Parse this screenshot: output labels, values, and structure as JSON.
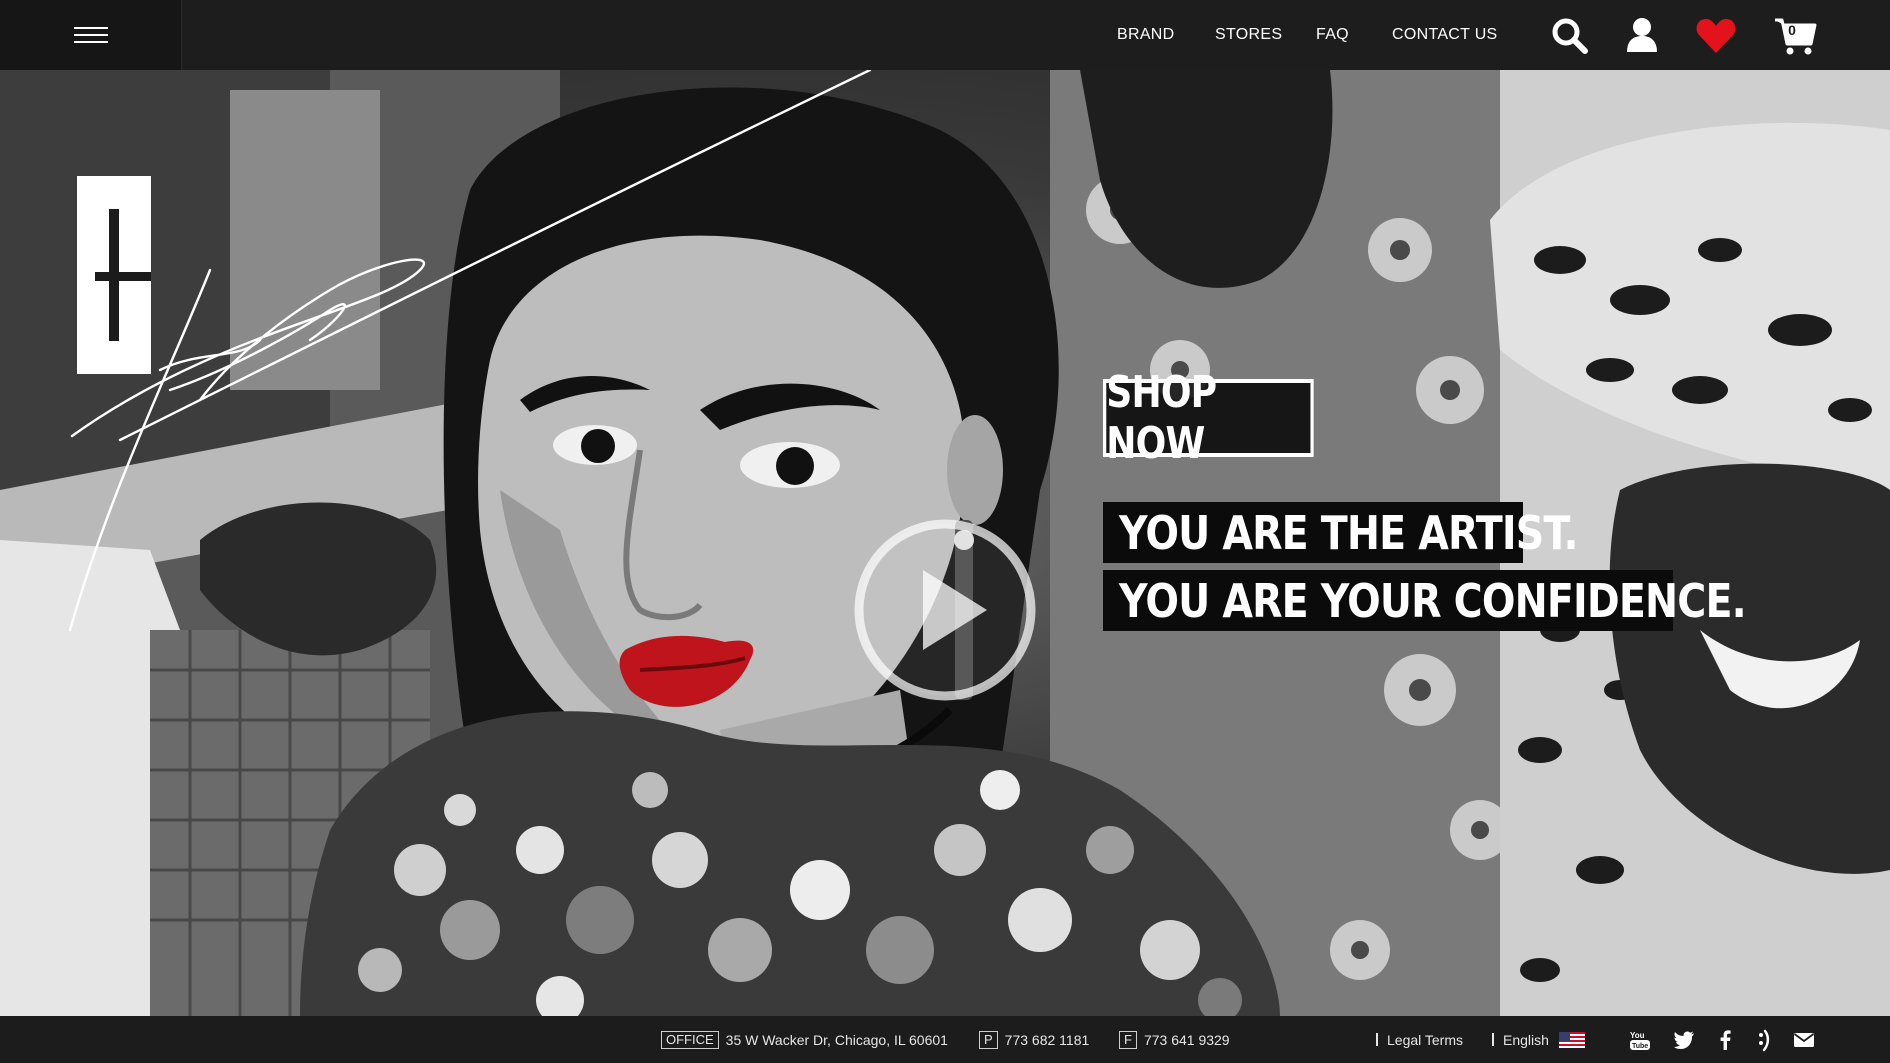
{
  "nav": {
    "items": [
      {
        "label": "BRAND"
      },
      {
        "label": "STORES"
      },
      {
        "label": "FAQ"
      },
      {
        "label": "CONTACT US"
      }
    ],
    "cart_count": "0",
    "icons": [
      "menu-icon",
      "search-icon",
      "user-icon",
      "heart-icon",
      "cart-icon"
    ],
    "heart_color": "#e4131b"
  },
  "hero": {
    "cta_label": "SHOP NOW",
    "tagline_1": "YOU ARE THE ARTIST.",
    "tagline_2": "YOU ARE YOUR CONFIDENCE.",
    "image_style": "black-and-white fashion photo, red lips accent",
    "accent_color": "#c0141c"
  },
  "footer": {
    "office_label": "OFFICE",
    "office_address": "35 W Wacker Dr, Chicago, IL 60601",
    "phone_label": "P",
    "phone": "773 682 1181",
    "fax_label": "F",
    "fax": "773 641 9329",
    "legal_label": "Legal Terms",
    "language_label": "English",
    "social_icons": [
      "youtube-icon",
      "twitter-icon",
      "facebook-icon",
      "vine-icon",
      "mail-icon"
    ]
  }
}
